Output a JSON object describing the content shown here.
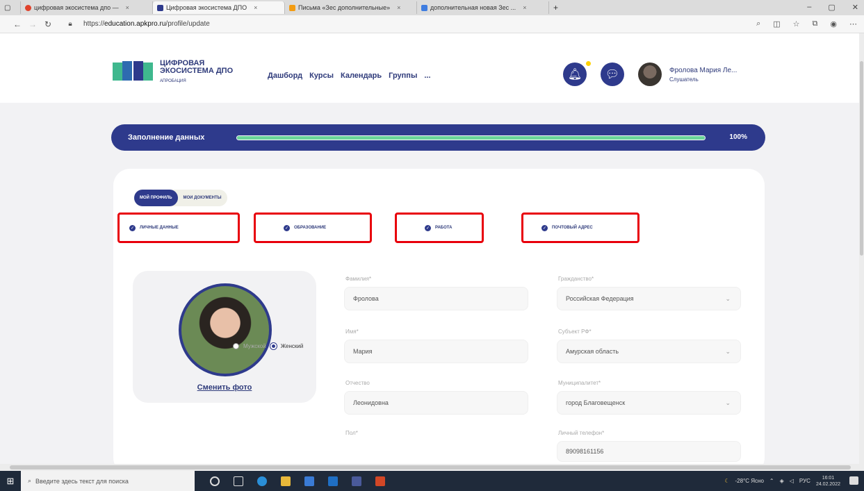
{
  "browser": {
    "tabs": [
      {
        "label": "цифровая экосистема дпо — ",
        "color": "#e0422c"
      },
      {
        "label": "Цифровая экосистема ДПО",
        "color": "#2e3a8c"
      },
      {
        "label": "Письма «Зес дополнительные»",
        "color": "#f39c12"
      },
      {
        "label": "дополнительная новая Зес ...",
        "color": "#3f7de0"
      }
    ],
    "url_prefix": "https://",
    "url_domain": "education.apkpro.ru",
    "url_path": "/profile/update"
  },
  "header": {
    "logo_line1": "ЦИФРОВАЯ",
    "logo_line2": "ЭКОСИСТЕМА ДПО",
    "logo_sub": "АПРОБАЦИЯ",
    "nav": [
      "Дашборд",
      "Курсы",
      "Календарь",
      "Группы",
      "..."
    ],
    "user_name": "Фролова Мария Ле...",
    "user_role": "Слушатель"
  },
  "progress": {
    "label": "Заполнение данных",
    "value": 100,
    "value_text": "100%"
  },
  "profile": {
    "tabs": [
      "МОЙ ПРОФИЛЬ",
      "МОИ ДОКУМЕНТЫ"
    ],
    "steps": [
      "ЛИЧНЫЕ ДАННЫЕ",
      "ОБРАЗОВАНИЕ",
      "РАБОТА",
      "ПОЧТОВЫЙ АДРЕС"
    ],
    "change_photo": "Сменить фото",
    "fields": {
      "surname_label": "Фамилия*",
      "surname": "Фролова",
      "name_label": "Имя*",
      "name": "Мария",
      "patronymic_label": "Отчество",
      "patronymic": "Леонидовна",
      "gender_label": "Пол*",
      "gender_male": "Мужской",
      "gender_female": "Женский",
      "citizenship_label": "Гражданство*",
      "citizenship": "Российская Федерация",
      "region_label": "Субъект РФ*",
      "region": "Амурская область",
      "municipality_label": "Муниципалитет*",
      "municipality": "город Благовещенск",
      "phone_label": "Личный телефон*",
      "phone": "89098161156"
    }
  },
  "taskbar": {
    "search_placeholder": "Введите здесь текст для поиска",
    "weather": "-28°C Ясно",
    "lang": "РУС",
    "time": "16:01",
    "date": "24.02.2022"
  }
}
